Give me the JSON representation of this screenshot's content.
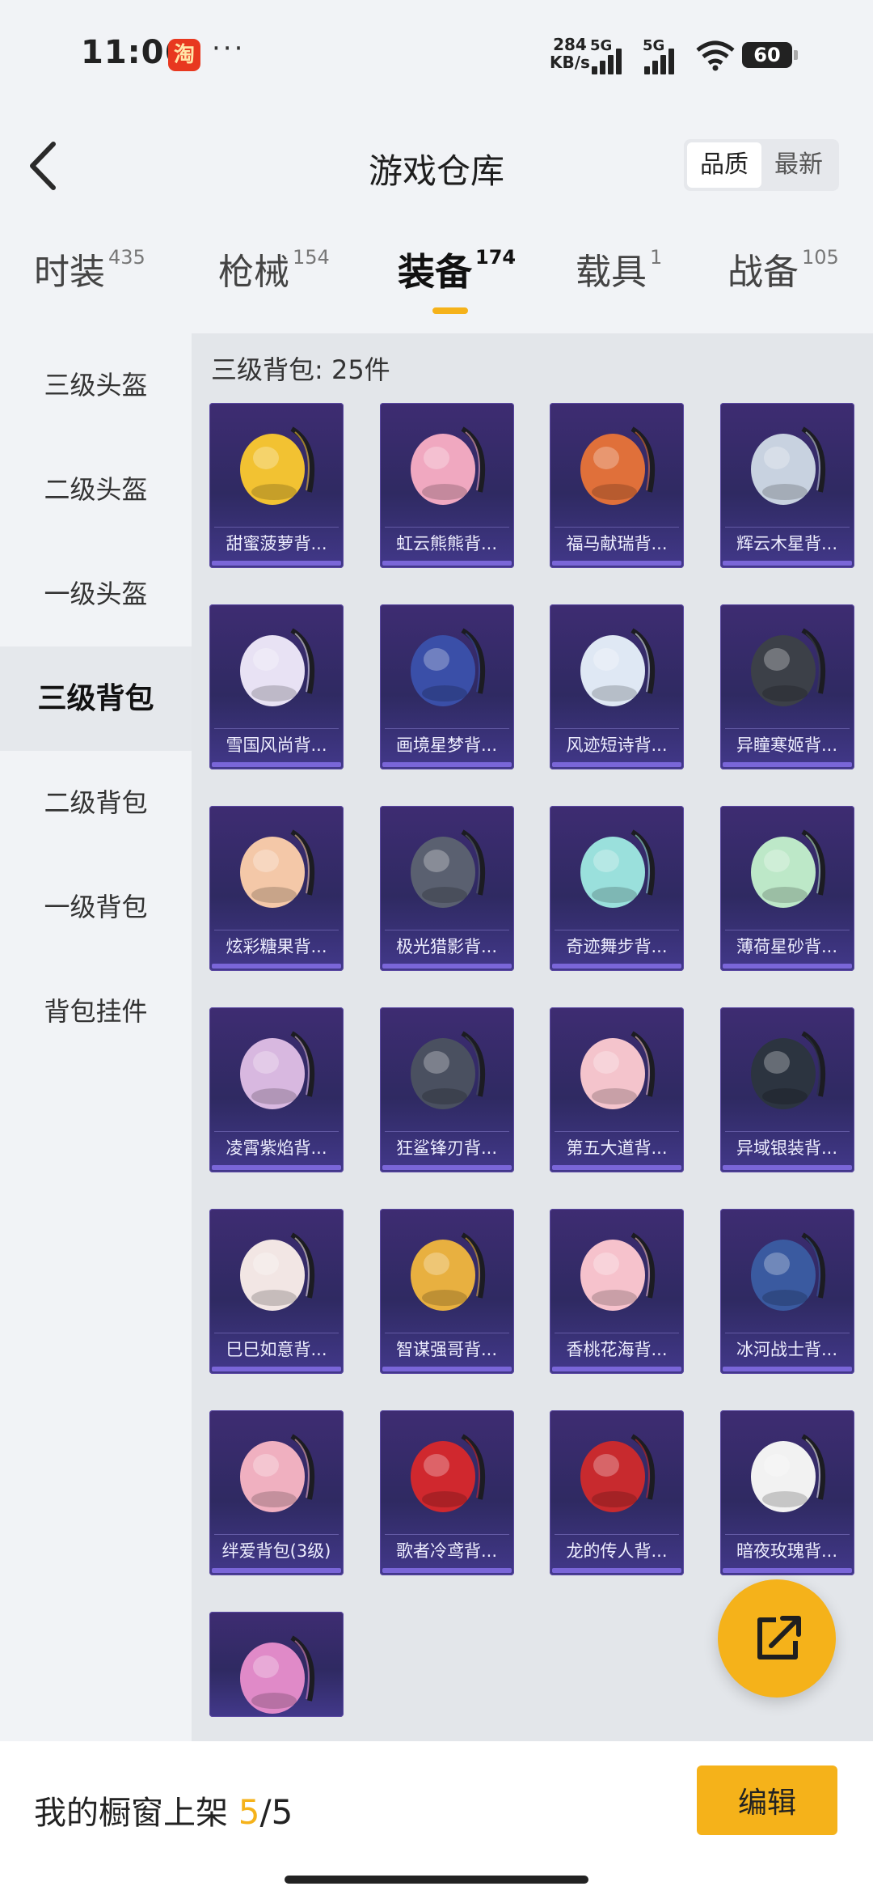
{
  "status_bar": {
    "time": "11:06",
    "taobao_glyph": "淘",
    "more": "···",
    "speed_value": "284",
    "speed_unit": "KB/s",
    "signal1": "5G",
    "signal2": "5G",
    "battery": "60"
  },
  "header": {
    "title": "游戏仓库",
    "sort_options": [
      "品质",
      "最新"
    ],
    "sort_active": "品质"
  },
  "tabs": [
    {
      "label": "时装",
      "count": "435"
    },
    {
      "label": "枪械",
      "count": "154"
    },
    {
      "label": "装备",
      "count": "174"
    },
    {
      "label": "载具",
      "count": "1"
    },
    {
      "label": "战备",
      "count": "105"
    }
  ],
  "active_tab": "装备",
  "sidebar": {
    "items": [
      "三级头盔",
      "二级头盔",
      "一级头盔",
      "三级背包",
      "二级背包",
      "一级背包",
      "背包挂件"
    ],
    "active": "三级背包"
  },
  "section_title": "三级背包: 25件",
  "items": [
    {
      "name": "甜蜜菠萝背...",
      "icon": "pineapple-backpack-icon",
      "color": "#f2c232"
    },
    {
      "name": "虹云熊熊背...",
      "icon": "pink-bear-backpack-icon",
      "color": "#f0a8c0"
    },
    {
      "name": "福马献瑞背...",
      "icon": "horse-backpack-icon",
      "color": "#e0703a"
    },
    {
      "name": "辉云木星背...",
      "icon": "jupiter-backpack-icon",
      "color": "#c8d2e0"
    },
    {
      "name": "雪国风尚背...",
      "icon": "penguin-backpack-icon",
      "color": "#e8e2f4"
    },
    {
      "name": "画境星梦背...",
      "icon": "mirror-backpack-icon",
      "color": "#3a4fa8"
    },
    {
      "name": "风迹短诗背...",
      "icon": "gift-box-backpack-icon",
      "color": "#dfe8f4"
    },
    {
      "name": "异瞳寒姬背...",
      "icon": "rabbit-backpack-icon",
      "color": "#3c4048"
    },
    {
      "name": "炫彩糖果背...",
      "icon": "donut-backpack-icon",
      "color": "#f4c8a8"
    },
    {
      "name": "极光猎影背...",
      "icon": "quiver-backpack-icon",
      "color": "#5a6070"
    },
    {
      "name": "奇迹舞步背...",
      "icon": "wings-backpack-icon",
      "color": "#9ae0dc"
    },
    {
      "name": "薄荷星砂背...",
      "icon": "mint-pouch-backpack-icon",
      "color": "#bde8c8"
    },
    {
      "name": "凌霄紫焰背...",
      "icon": "lotus-backpack-icon",
      "color": "#d8b8e0"
    },
    {
      "name": "狂鲨锋刃背...",
      "icon": "shark-backpack-icon",
      "color": "#4a5060"
    },
    {
      "name": "第五大道背...",
      "icon": "pink-school-backpack-icon",
      "color": "#f4c4cc"
    },
    {
      "name": "异域银装背...",
      "icon": "tactical-backpack-icon",
      "color": "#2c3440"
    },
    {
      "name": "巳巳如意背...",
      "icon": "snake-backpack-icon",
      "color": "#f2e6e4"
    },
    {
      "name": "智谋强哥背...",
      "icon": "bee-backpack-icon",
      "color": "#e8b040"
    },
    {
      "name": "香桃花海背...",
      "icon": "flower-dress-backpack-icon",
      "color": "#f6c2cc"
    },
    {
      "name": "冰河战士背...",
      "icon": "blue-armor-backpack-icon",
      "color": "#3a5aa0"
    },
    {
      "name": "绊爱背包(3级)",
      "icon": "heart-backpack-icon",
      "color": "#f0b0c0"
    },
    {
      "name": "歌者冷鸢背...",
      "icon": "red-pouch-backpack-icon",
      "color": "#d0282e"
    },
    {
      "name": "龙的传人背...",
      "icon": "red-travel-backpack-icon",
      "color": "#c82a2e"
    },
    {
      "name": "暗夜玫瑰背...",
      "icon": "doll-backpack-icon",
      "color": "#f2f2f2"
    },
    {
      "name": "",
      "icon": "boombox-backpack-icon",
      "color": "#e08ac8"
    }
  ],
  "float_button": {
    "icon": "share-external-icon"
  },
  "bottom_bar": {
    "label": "我的橱窗上架",
    "count": "5",
    "total": "/5",
    "edit_label": "编辑"
  }
}
